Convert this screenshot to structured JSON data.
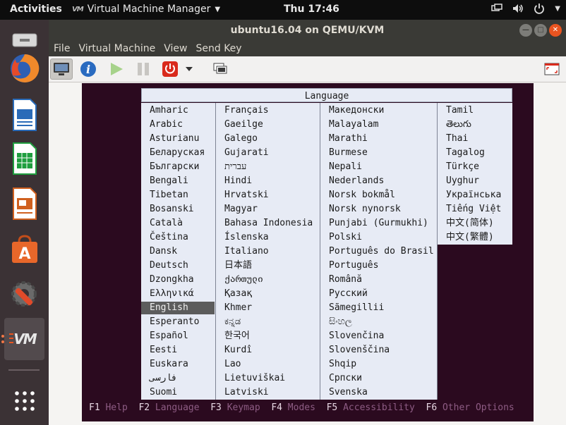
{
  "topbar": {
    "activities": "Activities",
    "app_menu": "Virtual Machine Manager",
    "app_icon_text": "VM",
    "clock": "Thu 17:46"
  },
  "window": {
    "title": "ubuntu16.04 on QEMU/KVM",
    "menu": [
      "File",
      "Virtual Machine",
      "View",
      "Send Key"
    ]
  },
  "installer": {
    "title": "Language",
    "columns": [
      [
        "Amharic",
        "Arabic",
        "Asturianu",
        "Беларуская",
        "Български",
        "Bengali",
        "Tibetan",
        "Bosanski",
        "Català",
        "Čeština",
        "Dansk",
        "Deutsch",
        "Dzongkha",
        "Ελληνικά",
        "English",
        "Esperanto",
        "Español",
        "Eesti",
        "Euskara",
        "فارسی",
        "Suomi"
      ],
      [
        "Français",
        "Gaeilge",
        "Galego",
        "Gujarati",
        "עברית",
        "Hindi",
        "Hrvatski",
        "Magyar",
        "Bahasa Indonesia",
        "Íslenska",
        "Italiano",
        "日本語",
        "ქართული",
        "Қазақ",
        "Khmer",
        "ಕನ್ನಡ",
        "한국어",
        "Kurdî",
        "Lao",
        "Lietuviškai",
        "Latviski"
      ],
      [
        "Македонски",
        "Malayalam",
        "Marathi",
        "Burmese",
        "Nepali",
        "Nederlands",
        "Norsk bokmål",
        "Norsk nynorsk",
        "Punjabi (Gurmukhi)",
        "Polski",
        "Português do Brasil",
        "Português",
        "Română",
        "Русский",
        "Sãmegillii",
        "සිංහල",
        "Slovenčina",
        "Slovenščina",
        "Shqip",
        "Српски",
        "Svenska"
      ],
      [
        "Tamil",
        "తెలుగు",
        "Thai",
        "Tagalog",
        "Türkçe",
        "Uyghur",
        "Українська",
        "Tiếng Việt",
        "中文(简体)",
        "中文(繁體)"
      ]
    ],
    "selected": "English",
    "fkeys": [
      {
        "key": "F1",
        "label": "Help"
      },
      {
        "key": "F2",
        "label": "Language"
      },
      {
        "key": "F3",
        "label": "Keymap"
      },
      {
        "key": "F4",
        "label": "Modes"
      },
      {
        "key": "F5",
        "label": "Accessibility"
      },
      {
        "key": "F6",
        "label": "Other Options"
      }
    ]
  },
  "colors": {
    "installer_bg": "#2b0a1f",
    "menu_bg": "#e7ebf5",
    "selection": "#5c5c5c",
    "accent": "#e95420"
  },
  "dock_icons": [
    "removable-drive-icon",
    "firefox-icon",
    "writer-icon",
    "calc-icon",
    "impress-icon",
    "software-center-icon",
    "system-settings-icon",
    "virt-manager-icon",
    "app-grid-icon"
  ]
}
